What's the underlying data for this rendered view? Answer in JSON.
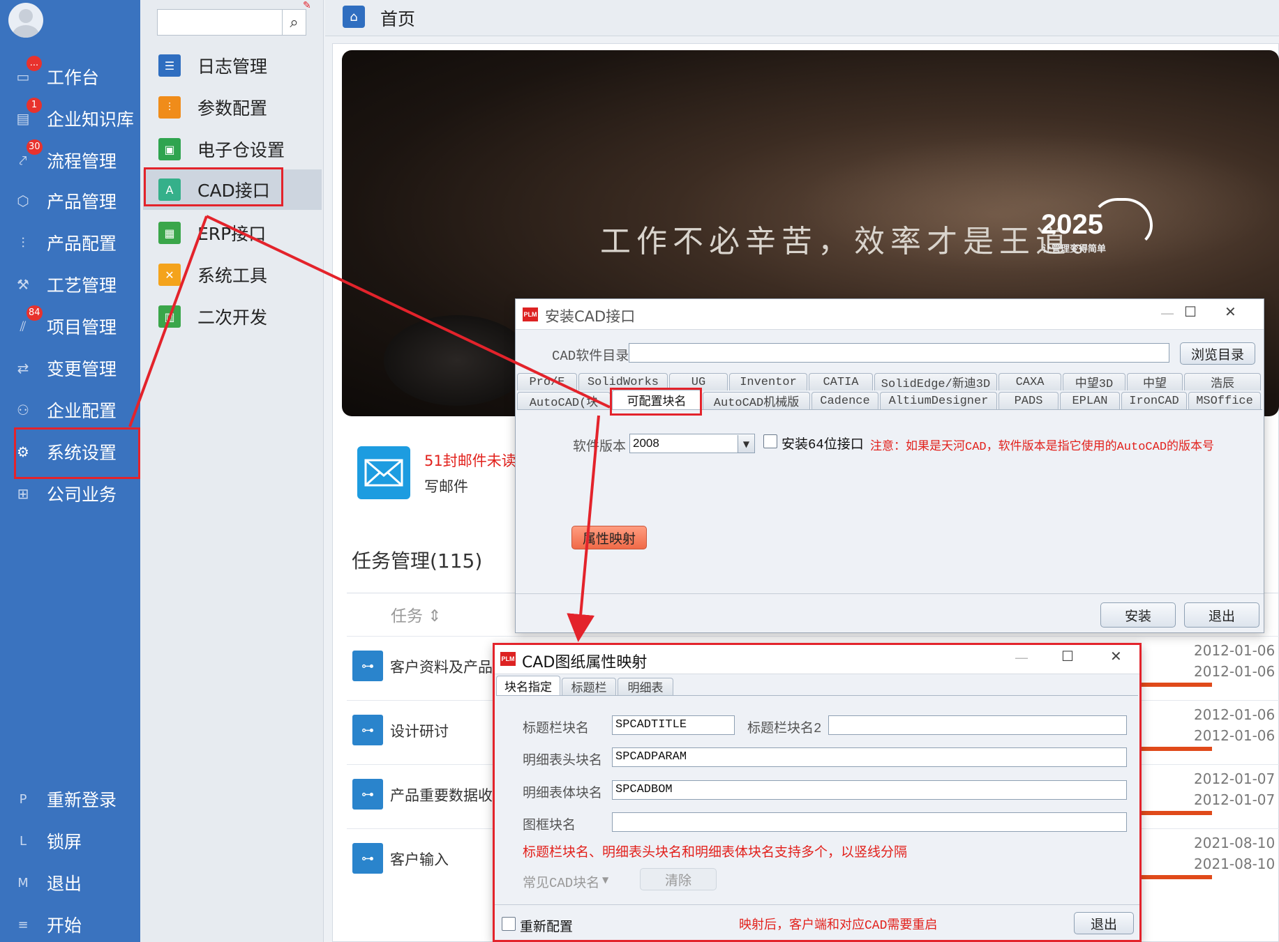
{
  "sidebar": {
    "items": [
      {
        "label": "工作台",
        "icon": "monitor-icon",
        "badge": "..."
      },
      {
        "label": "企业知识库",
        "icon": "book-icon",
        "badge": "1"
      },
      {
        "label": "流程管理",
        "icon": "flow-icon",
        "badge": "30"
      },
      {
        "label": "产品管理",
        "icon": "cube-icon",
        "badge": ""
      },
      {
        "label": "产品配置",
        "icon": "sliders-icon",
        "badge": ""
      },
      {
        "label": "工艺管理",
        "icon": "wrench-icon",
        "badge": ""
      },
      {
        "label": "项目管理",
        "icon": "chart-icon",
        "badge": "84"
      },
      {
        "label": "变更管理",
        "icon": "swap-icon",
        "badge": ""
      },
      {
        "label": "企业配置",
        "icon": "users-icon",
        "badge": ""
      },
      {
        "label": "系统设置",
        "icon": "gear-icon",
        "badge": ""
      },
      {
        "label": "公司业务",
        "icon": "grid-icon",
        "badge": ""
      }
    ],
    "bottom": [
      {
        "key": "P",
        "label": "重新登录"
      },
      {
        "key": "L",
        "label": "锁屏"
      },
      {
        "key": "M",
        "label": "退出"
      },
      {
        "key": "≡",
        "label": "开始"
      }
    ]
  },
  "submenu": {
    "search_placeholder": "",
    "items": [
      {
        "label": "日志管理",
        "icon": "log-icon",
        "color": "#2f6ec0"
      },
      {
        "label": "参数配置",
        "icon": "params-icon",
        "color": "#f08c1a"
      },
      {
        "label": "电子仓设置",
        "icon": "storage-icon",
        "color": "#2fa44f"
      },
      {
        "label": "CAD接口",
        "icon": "cad-icon",
        "color": "#35b08a"
      },
      {
        "label": "ERP接口",
        "icon": "erp-icon",
        "color": "#3aa64a"
      },
      {
        "label": "系统工具",
        "icon": "tools-icon",
        "color": "#f4a31c"
      },
      {
        "label": "二次开发",
        "icon": "dev-icon",
        "color": "#3aa64a"
      }
    ]
  },
  "topbar": {
    "title": "首页"
  },
  "banner": {
    "slogan": "工作不必辛苦，效率才是王道。",
    "logo": "2025",
    "logo_sub": "让管理变得简单"
  },
  "mail": {
    "unread": "51封邮件未读",
    "compose": "写邮件"
  },
  "tasks": {
    "header": "任务管理(115)",
    "column": "任务 ⇕",
    "rows": [
      {
        "name": "客户资料及产品",
        "d1": "2012-01-06",
        "d2": "2012-01-06"
      },
      {
        "name": "设计研讨",
        "d1": "2012-01-06",
        "d2": "2012-01-06"
      },
      {
        "name": "产品重要数据收",
        "d1": "2012-01-07",
        "d2": "2012-01-07"
      },
      {
        "name": "客户输入",
        "d1": "2021-08-10",
        "d2": "2021-08-10"
      }
    ]
  },
  "install_dialog": {
    "title": "安装CAD接口",
    "dir_label": "CAD软件目录",
    "dir_value": "",
    "browse": "浏览目录",
    "tabs_row1": [
      "Pro/E",
      "SolidWorks",
      "UG",
      "Inventor",
      "CATIA",
      "SolidEdge/新迪3D",
      "CAXA",
      "中望3D",
      "中望",
      "浩辰"
    ],
    "tabs_row2": [
      "AutoCAD(块",
      "可配置块名",
      "AutoCAD机械版",
      "Cadence",
      "AltiumDesigner",
      "PADS",
      "EPLAN",
      "IronCAD",
      "MSOffice"
    ],
    "version_label": "软件版本",
    "version_value": "2008",
    "x64_label": "安装64位接口",
    "note": "注意：如果是天河CAD，软件版本是指它使用的AutoCAD的版本号",
    "map_button": "属性映射",
    "install": "安装",
    "exit": "退出"
  },
  "map_dialog": {
    "title": "CAD图纸属性映射",
    "tabs": [
      "块名指定",
      "标题栏",
      "明细表"
    ],
    "title_block_label": "标题栏块名",
    "title_block_value": "SPCADTITLE",
    "title_block2_label": "标题栏块名2",
    "title_block2_value": "",
    "bom_head_label": "明细表头块名",
    "bom_head_value": "SPCADPARAM",
    "bom_body_label": "明细表体块名",
    "bom_body_value": "SPCADBOM",
    "frame_label": "图框块名",
    "frame_value": "",
    "hint": "标题栏块名、明细表头块名和明细表体块名支持多个，以竖线分隔",
    "common_label": "常见CAD块名",
    "clear": "清除",
    "reconfig": "重新配置",
    "note": "映射后，客户端和对应CAD需要重启",
    "exit": "退出"
  },
  "colors": {
    "sidebar": "#3a73bf",
    "highlight": "#e3232b",
    "accent_orange": "#f27a5a"
  }
}
